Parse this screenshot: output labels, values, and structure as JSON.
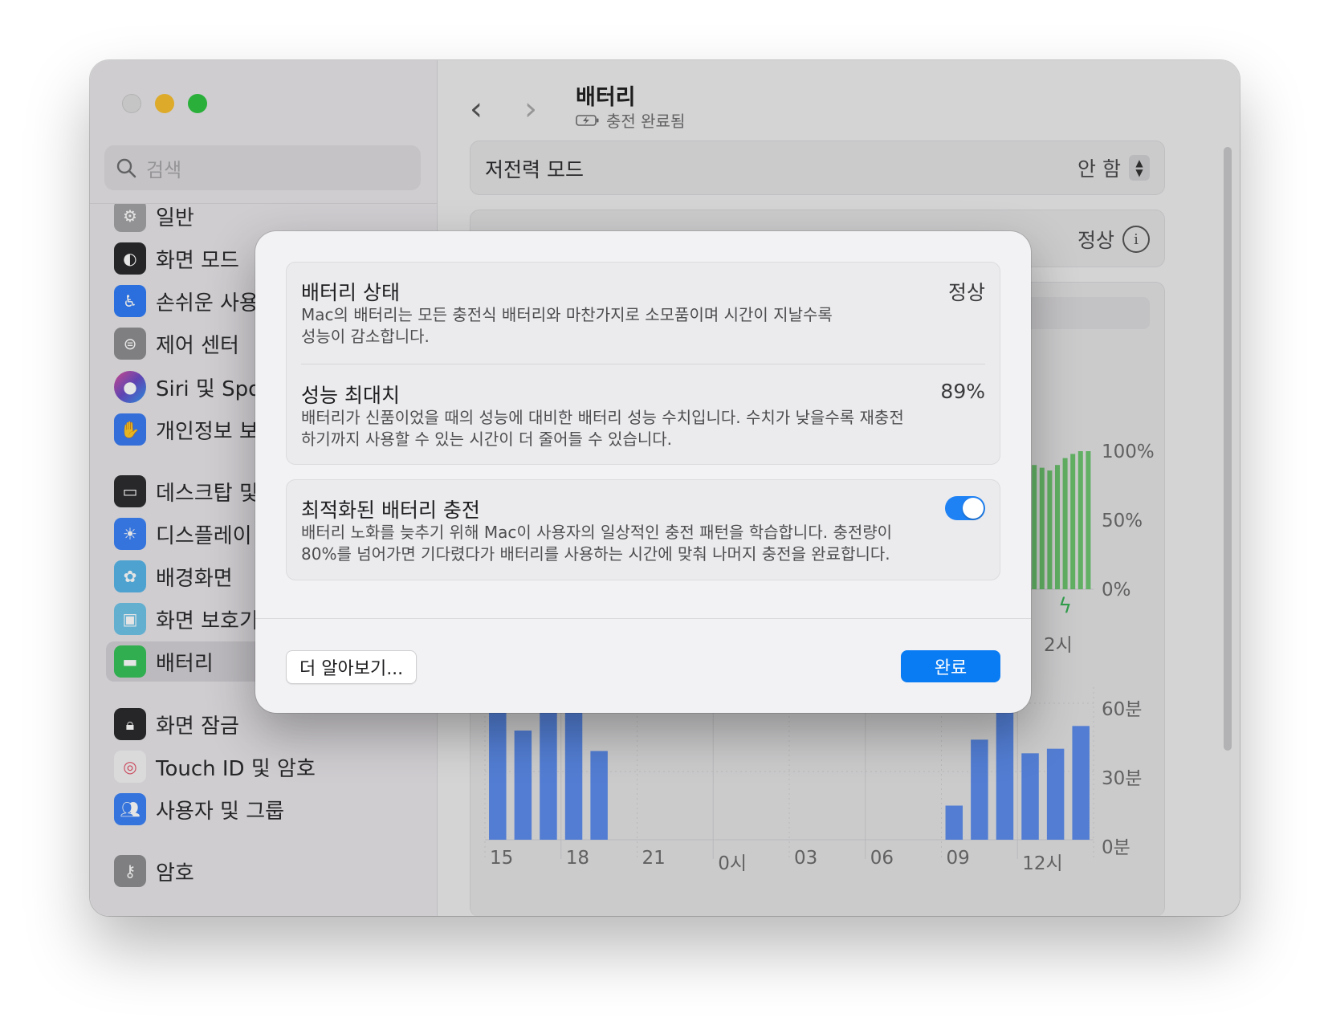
{
  "sidebar": {
    "search_placeholder": "검색",
    "items": [
      {
        "label": "일반",
        "icon": "gear-icon",
        "color": "#9b9b9d"
      },
      {
        "label": "화면 모드",
        "icon": "appearance-icon",
        "color": "#1f1f21"
      },
      {
        "label": "손쉬운 사용",
        "icon": "accessibility-icon",
        "color": "#2f7cf6"
      },
      {
        "label": "제어 센터",
        "icon": "control-center-icon",
        "color": "#8e8e90"
      },
      {
        "label": "Siri 및 Spotlight",
        "icon": "siri-icon",
        "color": "#6a4cc7"
      },
      {
        "label": "개인정보 보호 및 보안",
        "icon": "hand-icon",
        "color": "#3a7bf1"
      },
      {
        "label": "데스크탑 및 Dock",
        "icon": "desktop-icon",
        "color": "#2d2d2f"
      },
      {
        "label": "디스플레이",
        "icon": "sun-icon",
        "color": "#3b82f6"
      },
      {
        "label": "배경화면",
        "icon": "flower-icon",
        "color": "#57b5e8"
      },
      {
        "label": "화면 보호기",
        "icon": "screensaver-icon",
        "color": "#6fc3e8"
      },
      {
        "label": "배터리",
        "icon": "battery-icon",
        "color": "#36c25a"
      },
      {
        "label": "화면 잠금",
        "icon": "lock-icon",
        "color": "#2b2b2d"
      },
      {
        "label": "Touch ID 및 암호",
        "icon": "fingerprint-icon",
        "color": "#f3f3f3"
      },
      {
        "label": "사용자 및 그룹",
        "icon": "users-icon",
        "color": "#3b82f6"
      },
      {
        "label": "암호",
        "icon": "key-icon",
        "color": "#8e8e90"
      }
    ]
  },
  "header": {
    "title": "배터리",
    "subtitle": "충전 완료됨"
  },
  "main": {
    "low_power_label": "저전력 모드",
    "low_power_value": "안 함",
    "battery_health_value": "정상"
  },
  "chart_level": {
    "y_ticks": [
      "100%",
      "50%",
      "0%"
    ],
    "x_label_partial": "2시",
    "values": [
      95,
      92,
      90,
      88,
      86,
      90,
      95,
      98,
      100,
      100
    ],
    "bar_color": "#6cc46f"
  },
  "chart_usage": {
    "y_ticks": [
      "60분",
      "30분",
      "0분"
    ],
    "x_ticks": [
      "15",
      "18",
      "21",
      "0시",
      "03",
      "06",
      "09",
      "12시"
    ],
    "ymax": 60,
    "values": [
      58,
      48,
      59,
      60,
      39,
      0,
      0,
      0,
      0,
      0,
      0,
      0,
      0,
      0,
      0,
      0,
      0,
      0,
      15,
      44,
      60,
      38,
      40,
      50
    ],
    "bar_color": "#5c8cea"
  },
  "modal": {
    "health": {
      "title": "배터리 상태",
      "value": "정상",
      "desc_line1": "Mac의 배터리는 모든 충전식 배터리와 마찬가지로 소모품이며 시간이 지날수록",
      "desc_line2": "성능이 감소합니다."
    },
    "capacity": {
      "title": "성능 최대치",
      "value": "89%",
      "desc_line1": "배터리가 신품이었을 때의 성능에 대비한 배터리 성능 수치입니다. 수치가 낮을수록 재충전",
      "desc_line2": "하기까지 사용할 수 있는 시간이 더 줄어들 수 있습니다."
    },
    "optimized": {
      "title": "최적화된 배터리 충전",
      "enabled": true,
      "desc_line1": "배터리 노화를 늦추기 위해 Mac이 사용자의 일상적인 충전 패턴을 학습합니다. 충전량이",
      "desc_line2": "80%를 넘어가면 기다렸다가 배터리를 사용하는 시간에 맞춰 나머지 충전을 완료합니다."
    },
    "learn_more_label": "더 알아보기...",
    "done_label": "완료"
  }
}
